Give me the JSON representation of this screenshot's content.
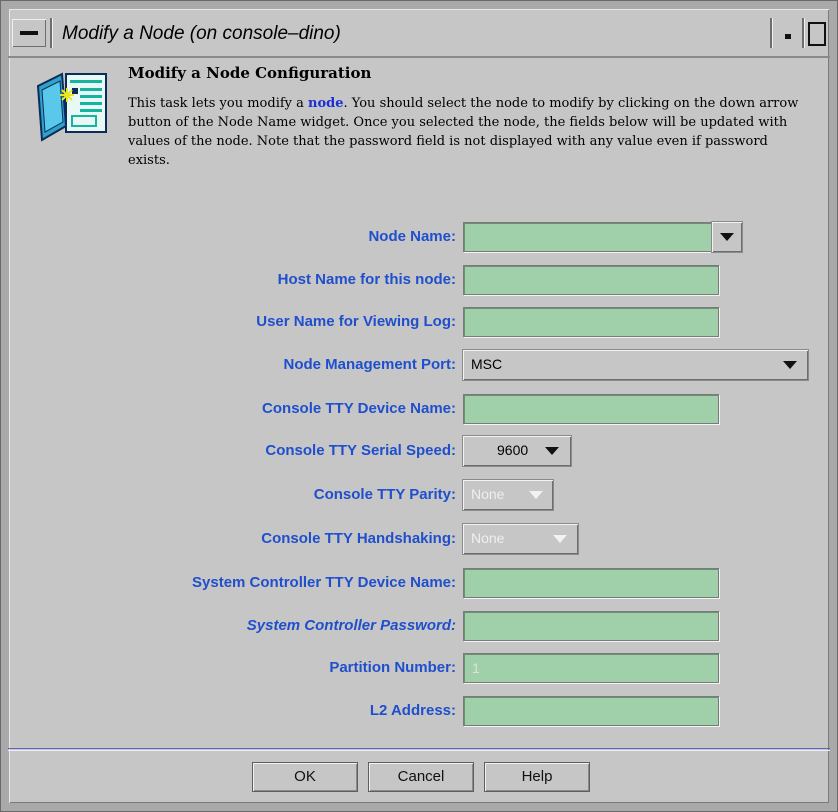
{
  "window": {
    "title": "Modify a Node (on console–dino)"
  },
  "header": {
    "heading": "Modify a Node Configuration",
    "desc_part1": "This task lets you modify a ",
    "desc_link": "node",
    "desc_part2": ". You should select the node to modify by clicking on the down arrow button of the Node Name widget. Once you selected the node, the fields below will be updated with values of the node. Note that the password field is not displayed with any value even if password exists.",
    "icon": "node-config-icon"
  },
  "form": {
    "node_name": {
      "label": "Node Name:",
      "value": ""
    },
    "host_name": {
      "label": "Host Name for this node:",
      "value": ""
    },
    "user_name": {
      "label": "User Name for Viewing Log:",
      "value": ""
    },
    "mgmt_port": {
      "label": "Node Management Port:",
      "value": "MSC"
    },
    "console_tty_device": {
      "label": "Console TTY Device Name:",
      "value": ""
    },
    "console_tty_speed": {
      "label": "Console TTY Serial Speed:",
      "value": "9600"
    },
    "console_tty_parity": {
      "label": "Console TTY Parity:",
      "value": "None"
    },
    "console_tty_handshaking": {
      "label": "Console TTY Handshaking:",
      "value": "None"
    },
    "sys_ctrl_tty_device": {
      "label": "System Controller TTY Device Name:",
      "value": ""
    },
    "sys_ctrl_password": {
      "label": "System Controller Password:",
      "value": ""
    },
    "partition_number": {
      "label": "Partition Number:",
      "value": "1"
    },
    "l2_address": {
      "label": "L2 Address:",
      "value": ""
    }
  },
  "buttons": {
    "ok": "OK",
    "cancel": "Cancel",
    "help": "Help"
  },
  "colors": {
    "label_blue": "#1f4fcc",
    "field_green": "#9fd0a9",
    "link_blue": "#1a2fd6"
  }
}
